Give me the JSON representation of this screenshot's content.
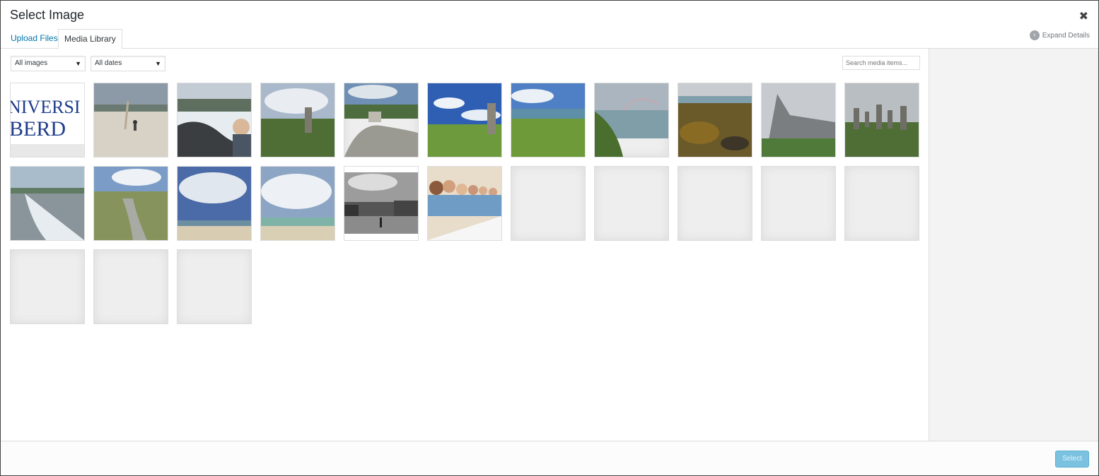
{
  "modal": {
    "title": "Select Image",
    "close_glyph": "✖",
    "expand_details": "Expand Details",
    "expand_icon": "chevron-left-circle-icon"
  },
  "tabs": [
    {
      "label": "Upload Files",
      "active": false
    },
    {
      "label": "Media Library",
      "active": true
    }
  ],
  "filters": {
    "type": "All images",
    "date": "All dates",
    "search_placeholder": "Search media items..."
  },
  "media": {
    "image_descriptions": [
      "university-logo",
      "beach-person-walking",
      "waves-rocks-child",
      "standing-stone-sky",
      "stone-cairn",
      "standing-stone-blue-sky",
      "coast-grass",
      "bay-rainbow",
      "seaweed-rocks",
      "stone-broch",
      "standing-stones-circle",
      "beach-surf",
      "stream-dunes",
      "beach-clouds",
      "beach-shore-clouds",
      "town-street-bw",
      "group-people-smiling"
    ],
    "placeholder_count": 8,
    "logo_lines": [
      "NIVERSI",
      "BERD"
    ]
  },
  "footer": {
    "select_label": "Select"
  },
  "colors": {
    "link": "#0073aa",
    "primary_disabled": "#7ac2e0",
    "sidebar_bg": "#f3f3f3"
  }
}
